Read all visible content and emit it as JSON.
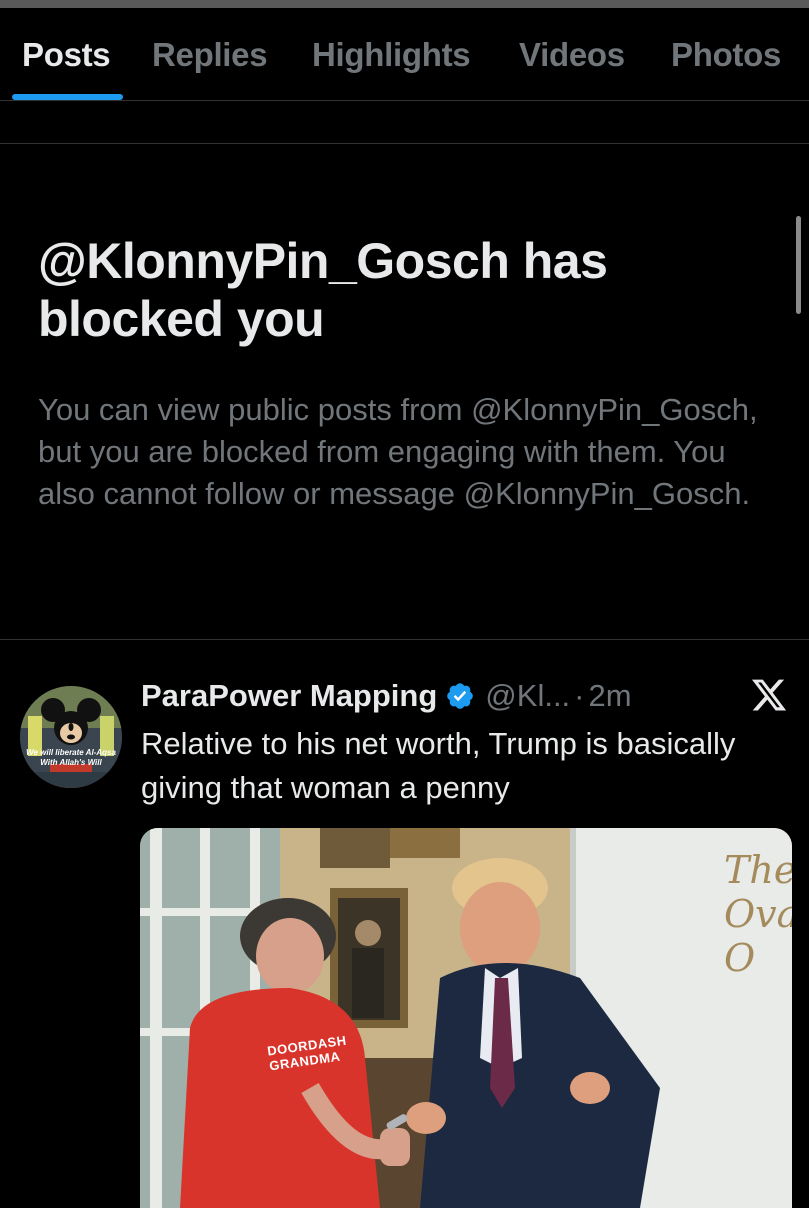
{
  "tabs": [
    {
      "label": "Posts",
      "active": true
    },
    {
      "label": "Replies",
      "active": false
    },
    {
      "label": "Highlights",
      "active": false
    },
    {
      "label": "Videos",
      "active": false
    },
    {
      "label": "Photos",
      "active": false
    }
  ],
  "blocked": {
    "title": "@KlonnyPin_Gosch has blocked you",
    "description": "You can view public posts from @KlonnyPin_Gosch, but you are blocked from engaging with them. You also cannot follow or message @KlonnyPin_Gosch."
  },
  "post": {
    "avatar_text": "We will liberate Al-Aqsa With Allah's Will",
    "author_name": "ParaPower Mapping",
    "verified": true,
    "handle": "@Kl...",
    "separator": "·",
    "time": "2m",
    "text": "Relative to his net worth, Trump is basically giving that woman a penny",
    "media": {
      "wall_text": "The Oval O",
      "shirt_text": "DOORDASH GRANDMA"
    }
  },
  "colors": {
    "background": "#000000",
    "text_primary": "#e7e9ea",
    "text_secondary": "#71767b",
    "accent": "#1d9bf0",
    "divider": "#2f3336"
  },
  "icons": {
    "verified": "verified-badge-icon",
    "x_logo": "x-logo-icon"
  }
}
